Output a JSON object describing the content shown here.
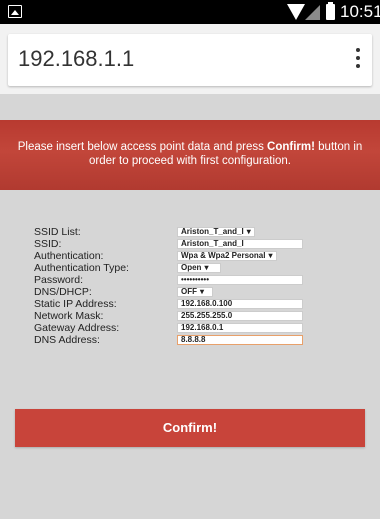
{
  "status_bar": {
    "time": "10:51"
  },
  "browser": {
    "url": "192.168.1.1"
  },
  "banner": {
    "text_before": "Please insert below access point data and press ",
    "bold_text": "Confirm!",
    "text_after": " button in order to proceed with first configuration."
  },
  "form": {
    "rows": [
      {
        "label": "SSID List:",
        "value": "Ariston_T_and_I"
      },
      {
        "label": "SSID:",
        "value": "Ariston_T_and_I"
      },
      {
        "label": "Authentication:",
        "value": "Wpa & Wpa2 Personal"
      },
      {
        "label": "Authentication Type:",
        "value": "Open"
      },
      {
        "label": "Password:",
        "value": "••••••••••"
      },
      {
        "label": "DNS/DHCP:",
        "value": "OFF"
      },
      {
        "label": "Static IP Address:",
        "value": "192.168.0.100"
      },
      {
        "label": "Network Mask:",
        "value": "255.255.255.0"
      },
      {
        "label": "Gateway Address:",
        "value": "192.168.0.1"
      },
      {
        "label": "DNS Address:",
        "value": "8.8.8.8"
      }
    ]
  },
  "confirm_button": {
    "label": "Confirm!"
  },
  "colors": {
    "accent": "#c8443a",
    "banner": "#b83a30",
    "background": "#d6d6d6"
  }
}
